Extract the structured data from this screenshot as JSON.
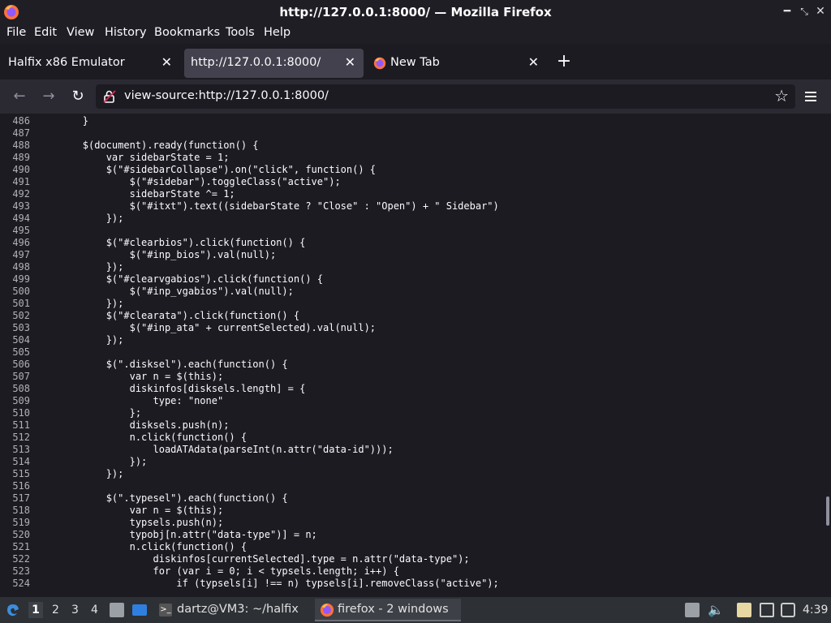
{
  "window": {
    "title": "http://127.0.0.1:8000/ — Mozilla Firefox",
    "controls": [
      "minimize",
      "maximize",
      "close"
    ]
  },
  "menu": [
    "File",
    "Edit",
    "View",
    "History",
    "Bookmarks",
    "Tools",
    "Help"
  ],
  "tabs": [
    {
      "label": "Halfix x86 Emulator",
      "active": false,
      "icon": "none"
    },
    {
      "label": "http://127.0.0.1:8000/",
      "active": true,
      "icon": "none"
    },
    {
      "label": "New Tab",
      "active": false,
      "icon": "firefox-icon"
    }
  ],
  "newtab_label": "+",
  "nav": {
    "url": "view-source:http://127.0.0.1:8000/",
    "back_icon": "arrow-left-icon",
    "forward_icon": "arrow-right-icon",
    "reload_icon": "reload-icon"
  },
  "source": {
    "lines": [
      {
        "n": "486",
        "code": "        }"
      },
      {
        "n": "487",
        "code": ""
      },
      {
        "n": "488",
        "code": "        $(document).ready(function() {"
      },
      {
        "n": "489",
        "code": "            var sidebarState = 1;"
      },
      {
        "n": "490",
        "code": "            $(\"#sidebarCollapse\").on(\"click\", function() {"
      },
      {
        "n": "491",
        "code": "                $(\"#sidebar\").toggleClass(\"active\");"
      },
      {
        "n": "492",
        "code": "                sidebarState ^= 1;"
      },
      {
        "n": "493",
        "code": "                $(\"#itxt\").text((sidebarState ? \"Close\" : \"Open\") + \" Sidebar\")"
      },
      {
        "n": "494",
        "code": "            });"
      },
      {
        "n": "495",
        "code": ""
      },
      {
        "n": "496",
        "code": "            $(\"#clearbios\").click(function() {"
      },
      {
        "n": "497",
        "code": "                $(\"#inp_bios\").val(null);"
      },
      {
        "n": "498",
        "code": "            });"
      },
      {
        "n": "499",
        "code": "            $(\"#clearvgabios\").click(function() {"
      },
      {
        "n": "500",
        "code": "                $(\"#inp_vgabios\").val(null);"
      },
      {
        "n": "501",
        "code": "            });"
      },
      {
        "n": "502",
        "code": "            $(\"#clearata\").click(function() {"
      },
      {
        "n": "503",
        "code": "                $(\"#inp_ata\" + currentSelected).val(null);"
      },
      {
        "n": "504",
        "code": "            });"
      },
      {
        "n": "505",
        "code": ""
      },
      {
        "n": "506",
        "code": "            $(\".disksel\").each(function() {"
      },
      {
        "n": "507",
        "code": "                var n = $(this);"
      },
      {
        "n": "508",
        "code": "                diskinfos[disksels.length] = {"
      },
      {
        "n": "509",
        "code": "                    type: \"none\""
      },
      {
        "n": "510",
        "code": "                };"
      },
      {
        "n": "511",
        "code": "                disksels.push(n);"
      },
      {
        "n": "512",
        "code": "                n.click(function() {"
      },
      {
        "n": "513",
        "code": "                    loadATAdata(parseInt(n.attr(\"data-id\")));"
      },
      {
        "n": "514",
        "code": "                });"
      },
      {
        "n": "515",
        "code": "            });"
      },
      {
        "n": "516",
        "code": ""
      },
      {
        "n": "517",
        "code": "            $(\".typesel\").each(function() {"
      },
      {
        "n": "518",
        "code": "                var n = $(this);"
      },
      {
        "n": "519",
        "code": "                typsels.push(n);"
      },
      {
        "n": "520",
        "code": "                typobj[n.attr(\"data-type\")] = n;"
      },
      {
        "n": "521",
        "code": "                n.click(function() {"
      },
      {
        "n": "522",
        "code": "                    diskinfos[currentSelected].type = n.attr(\"data-type\");"
      },
      {
        "n": "523",
        "code": "                    for (var i = 0; i < typsels.length; i++) {"
      },
      {
        "n": "524",
        "code": "                        if (typsels[i] !== n) typsels[i].removeClass(\"active\");"
      }
    ]
  },
  "taskbar": {
    "workspaces": [
      "1",
      "2",
      "3",
      "4"
    ],
    "current_workspace": "1",
    "items": [
      {
        "label": "dartz@VM3: ~/halfix",
        "icon": "terminal-icon"
      },
      {
        "label": "firefox - 2 windows",
        "icon": "firefox-icon"
      }
    ],
    "clock": "4:39"
  }
}
